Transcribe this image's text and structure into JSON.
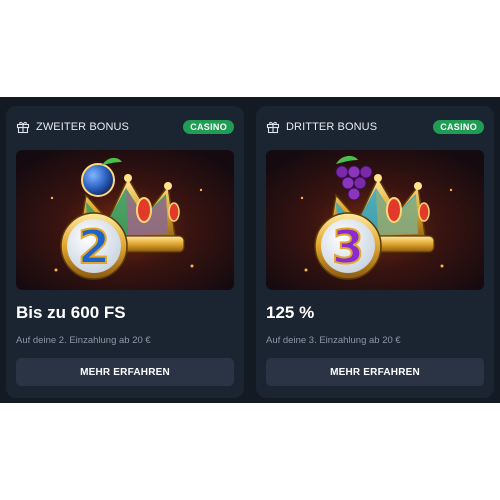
{
  "cards": [
    {
      "title": "ZWEITER BONUS",
      "badge": "CASINO",
      "headline": "Bis zu 600 FS",
      "subtext": "Auf deine 2. Einzahlung ab 20 €",
      "button": "MEHR ERFAHREN",
      "number": "2",
      "number_color": "#1e63c8",
      "fruit": "plum"
    },
    {
      "title": "DRITTER BONUS",
      "badge": "CASINO",
      "headline": "125 %",
      "subtext": "Auf deine 3. Einzahlung ab 20 €",
      "button": "MEHR ERFAHREN",
      "number": "3",
      "number_color": "#8a2bd0",
      "fruit": "grapes"
    }
  ],
  "colors": {
    "page_background": "#131a24",
    "card_background": "#1b2431",
    "badge_green": "#1f9d55",
    "button_background": "#2a3444",
    "subtext": "#8d97a8"
  },
  "icons": {
    "card_header": "gift-icon"
  }
}
